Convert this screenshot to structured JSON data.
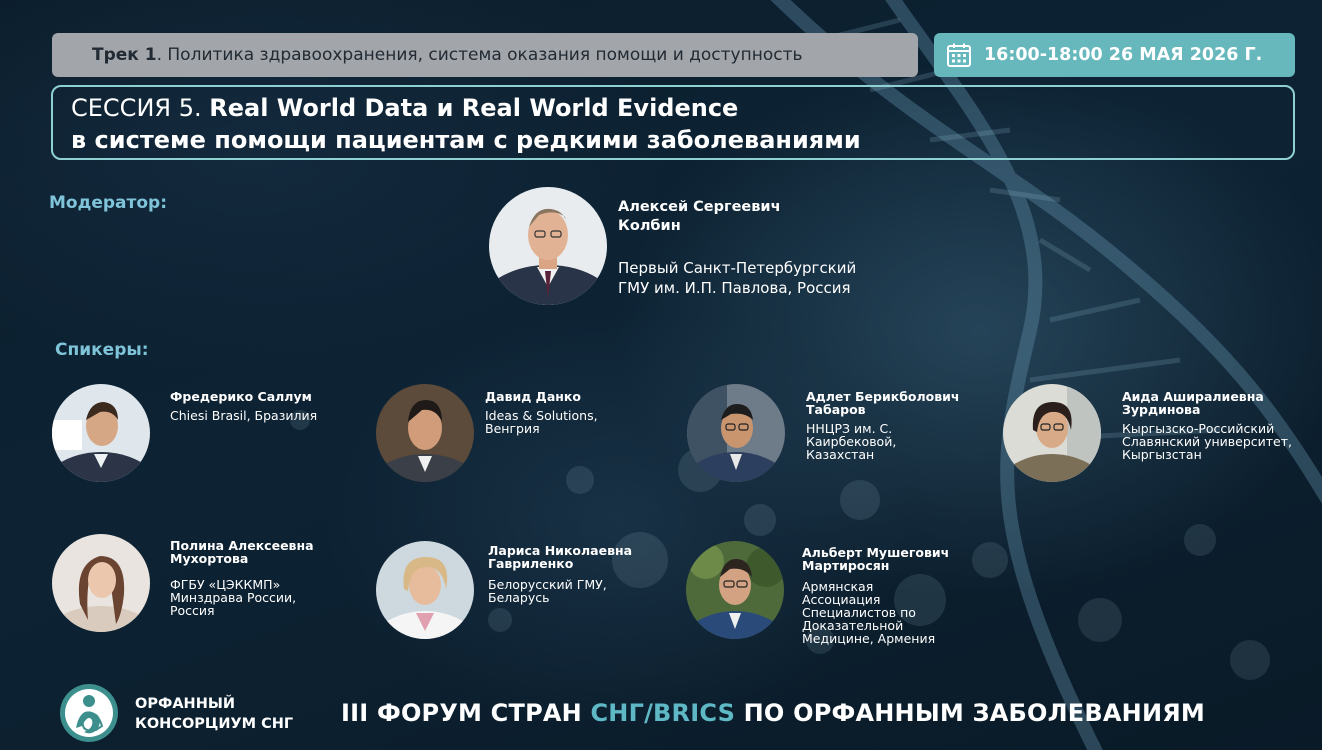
{
  "track": {
    "label": "Трек 1",
    "text": ". Политика здравоохранения, система оказания помощи и доступность"
  },
  "date": {
    "icon": "calendar-icon",
    "text": "16:00-18:00 26 МАЯ 2026 Г."
  },
  "session": {
    "prefix": "СЕССИЯ 5. ",
    "title_line1": "Real World Data и Real World Evidence",
    "title_line2": "в системе помощи пациентам с редкими заболеваниями"
  },
  "moderator_label": "Модератор:",
  "moderator": {
    "name": "Алексей Сергеевич Колбин",
    "org": "Первый Санкт-Петербургский ГМУ им. И.П. Павлова, Россия"
  },
  "speakers_label": "Спикеры:",
  "speakers": [
    {
      "name": "Фредерико Саллум",
      "org": "Chiesi Brasil, Бразилия"
    },
    {
      "name": "Давид Данко",
      "org": "Ideas & Solutions, Венгрия"
    },
    {
      "name": "Адлет Берикболович Табаров",
      "org": "ННЦРЗ им. С. Каирбековой, Казахстан"
    },
    {
      "name": "Аида Аширалиевна Зурдинова",
      "org": "Кыргызско-Российский Славянский университет, Кыргызстан"
    },
    {
      "name": "Полина Алексеевна Мухортова",
      "org": "ФГБУ «ЦЭККМП» Минздрава России, Россия"
    },
    {
      "name": "Лариса Николаевна Гавриленко",
      "org": "Белорусский ГМУ, Беларусь"
    },
    {
      "name": "Альберт Мушегович Мартиросян",
      "org": "Армянская Ассоциация Специалистов по Доказательной Медицине, Армения"
    }
  ],
  "footer": {
    "org_name": "ОРФАННЫЙ КОНСОРЦИУМ СНГ",
    "forum_part1": "III ФОРУМ СТРАН ",
    "forum_accent": "СНГ/BRICS",
    "forum_part2": " ПО ОРФАННЫМ ЗАБОЛЕВАНИЯМ"
  },
  "colors": {
    "accent": "#5fb8c6",
    "track_bar": "#a2a6ab",
    "date_bar": "#66b8bd",
    "label": "#7fc4d9"
  }
}
